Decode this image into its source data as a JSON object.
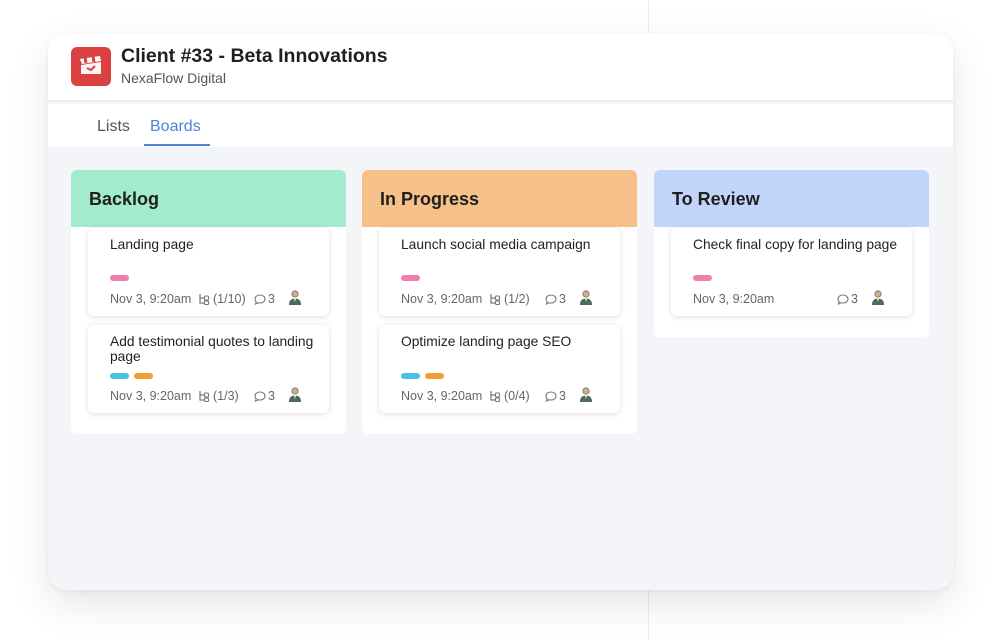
{
  "header": {
    "title": "Client #33 - Beta Innovations",
    "subtitle": "NexaFlow Digital"
  },
  "tabs": [
    {
      "label": "Lists",
      "active": false
    },
    {
      "label": "Boards",
      "active": true
    }
  ],
  "colors": {
    "accent": "#4d83d6",
    "logo": "#dc4141",
    "backlog": "#a2ebcc",
    "in_progress": "#f6c189",
    "to_review": "#c3d4fb",
    "tag_pink": "#f07fb0",
    "tag_blue": "#4cbfe6",
    "tag_orange": "#f0a032"
  },
  "columns": [
    {
      "name": "Backlog",
      "cards": [
        {
          "title": "Landing page",
          "tags": [
            "tag_pink"
          ],
          "date": "Nov 3, 9:20am",
          "subtasks": "(1/10)",
          "comments": "3",
          "avatar": "user-avatar-icon"
        },
        {
          "title": "Add testimonial quotes to landing page",
          "tags": [
            "tag_blue",
            "tag_orange"
          ],
          "date": "Nov 3, 9:20am",
          "subtasks": "(1/3)",
          "comments": "3",
          "avatar": "user-avatar-icon"
        }
      ]
    },
    {
      "name": "In Progress",
      "cards": [
        {
          "title": "Launch social media campaign",
          "tags": [
            "tag_pink"
          ],
          "date": "Nov 3, 9:20am",
          "subtasks": "(1/2)",
          "comments": "3",
          "avatar": "user-avatar-icon"
        },
        {
          "title": "Optimize landing page SEO",
          "tags": [
            "tag_blue",
            "tag_orange"
          ],
          "date": "Nov 3, 9:20am",
          "subtasks": "(0/4)",
          "comments": "3",
          "avatar": "user-avatar-icon"
        }
      ]
    },
    {
      "name": "To Review",
      "cards": [
        {
          "title": "Check final copy for landing page",
          "tags": [
            "tag_pink"
          ],
          "date": "Nov 3, 9:20am",
          "comments": "3",
          "avatar": "user-avatar-icon"
        }
      ]
    }
  ]
}
